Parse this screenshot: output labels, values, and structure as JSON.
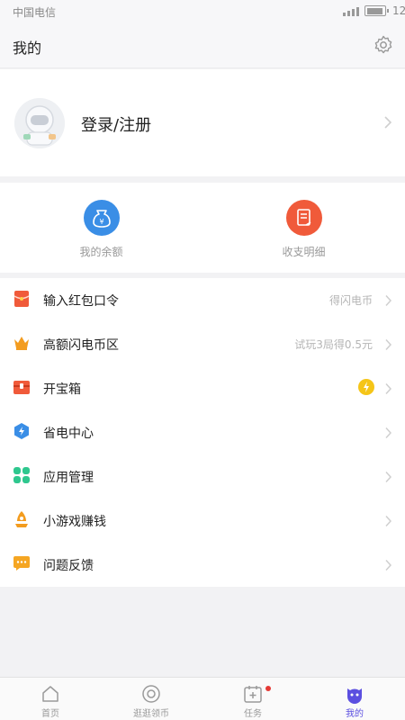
{
  "status_bar": {
    "carrier": "中国电信",
    "time": "12:"
  },
  "header": {
    "title": "我的"
  },
  "profile": {
    "login_label": "登录/注册"
  },
  "wallet": {
    "balance_label": "我的余额",
    "details_label": "收支明细"
  },
  "menu": {
    "items": [
      {
        "label": "输入红包口令",
        "hint": "得闪电币",
        "icon": "red-envelope-icon",
        "color": "#f05a3a"
      },
      {
        "label": "高额闪电币区",
        "hint": "试玩3局得0.5元",
        "icon": "crown-icon",
        "color": "#f39c1f"
      },
      {
        "label": "开宝箱",
        "hint": "",
        "icon": "treasure-chest-icon",
        "color": "#f05a3a"
      },
      {
        "label": "省电中心",
        "hint": "",
        "icon": "power-saving-icon",
        "color": "#3a8ee6"
      },
      {
        "label": "应用管理",
        "hint": "",
        "icon": "app-grid-icon",
        "color": "#2ec78e"
      },
      {
        "label": "小游戏赚钱",
        "hint": "",
        "icon": "game-rocket-icon",
        "color": "#f39c1f"
      },
      {
        "label": "问题反馈",
        "hint": "",
        "icon": "feedback-icon",
        "color": "#f5a623"
      }
    ]
  },
  "tabbar": {
    "tabs": [
      {
        "label": "首页",
        "icon": "home-icon"
      },
      {
        "label": "逛逛领币",
        "icon": "eye-icon"
      },
      {
        "label": "任务",
        "icon": "task-calendar-icon"
      },
      {
        "label": "我的",
        "icon": "profile-face-icon"
      }
    ],
    "active_index": 3
  },
  "colors": {
    "accent": "#5b4fe0",
    "red": "#f05a3a",
    "blue": "#3a8ee6",
    "gold": "#f5c518"
  }
}
